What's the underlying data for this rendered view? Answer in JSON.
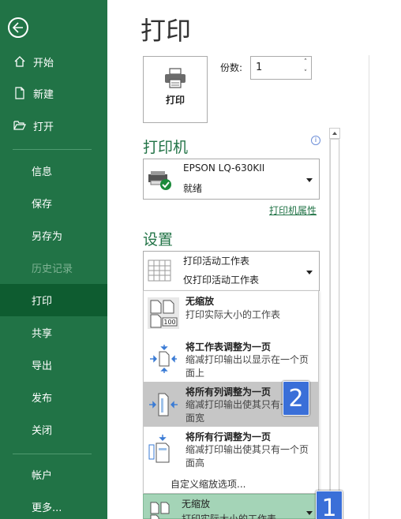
{
  "sidebar": {
    "back_label": "",
    "items": [
      {
        "label": "开始"
      },
      {
        "label": "新建"
      },
      {
        "label": "打开"
      },
      {
        "label": "信息"
      },
      {
        "label": "保存"
      },
      {
        "label": "另存为"
      },
      {
        "label": "历史记录"
      },
      {
        "label": "打印"
      },
      {
        "label": "共享"
      },
      {
        "label": "导出"
      },
      {
        "label": "发布"
      },
      {
        "label": "关闭"
      },
      {
        "label": "帐户"
      },
      {
        "label": "更多..."
      }
    ]
  },
  "main": {
    "title": "打印",
    "print_button": "打印",
    "copies_label": "份数:",
    "copies_value": "1",
    "printer_heading": "打印机",
    "printer_name": "EPSON LQ-630KII",
    "printer_status": "就绪",
    "printer_properties": "打印机属性",
    "settings_heading": "设置",
    "print_what_line1": "打印活动工作表",
    "print_what_line2": "仅打印活动工作表"
  },
  "scaling_menu": {
    "items": [
      {
        "title": "无缩放",
        "desc": "打印实际大小的工作表"
      },
      {
        "title": "将工作表调整为一页",
        "desc": "缩减打印输出以显示在一个页面上"
      },
      {
        "title": "将所有列调整为一页",
        "desc": "缩减打印输出使其只有一个页面宽"
      },
      {
        "title": "将所有行调整为一页",
        "desc": "缩减打印输出使其只有一个页面高"
      }
    ],
    "custom_option": "自定义缩放选项..."
  },
  "bottom_selection": {
    "title": "无缩放",
    "desc": "打印实际大小的工作表"
  },
  "badges": {
    "one": "1",
    "two": "2"
  },
  "colors": {
    "accent": "#217346",
    "sidebar_active": "#0e5c30",
    "badge": "#3a6fd8"
  }
}
